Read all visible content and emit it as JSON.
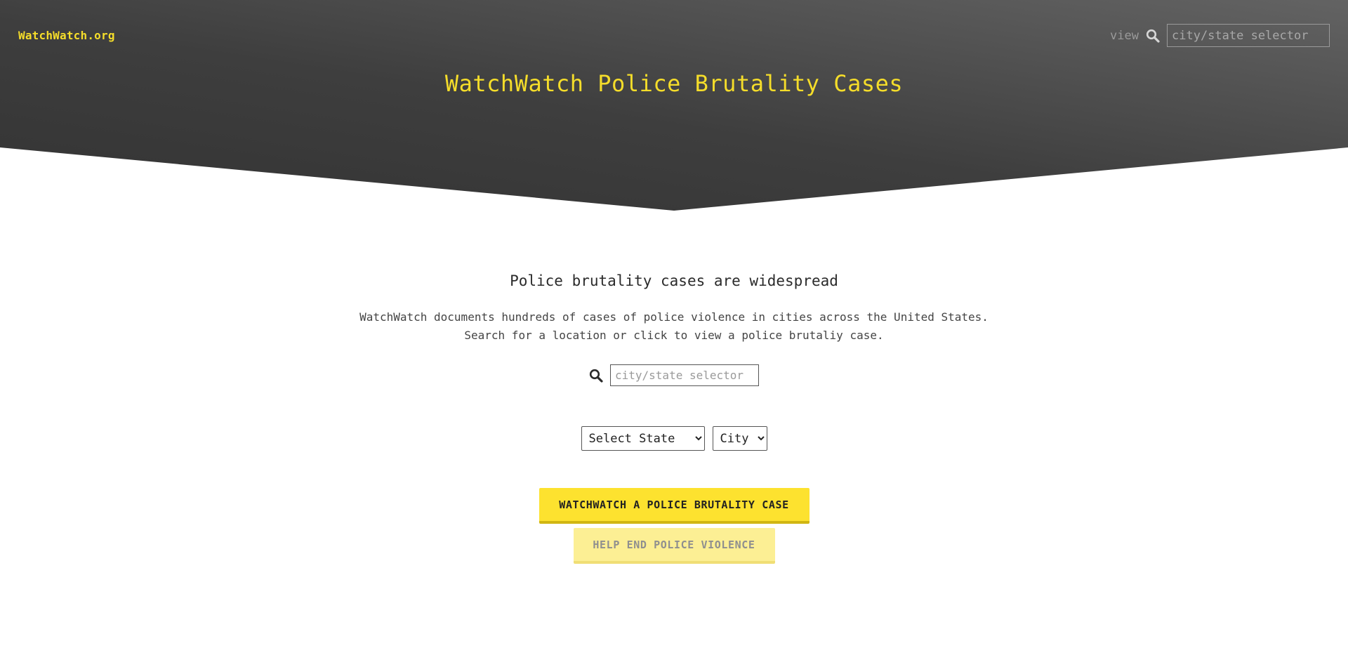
{
  "header": {
    "brand": "WatchWatch.org",
    "view_label": "view",
    "search_icon": "search-icon",
    "search_placeholder": "city/state selector",
    "title": "WatchWatch Police Brutality Cases"
  },
  "main": {
    "section_title": "Police brutality cases are widespread",
    "description_line1": "WatchWatch documents hundreds of cases of police violence in cities across the United States.",
    "description_line2": "Search for a location or click to view a police brutaliy case.",
    "search_icon": "search-icon",
    "search_placeholder": "city/state selector",
    "state_select": {
      "selected": "Select State"
    },
    "city_select": {
      "selected": "City"
    },
    "primary_button": "WATCHWATCH A POLICE BRUTALITY CASE",
    "secondary_button": "HELP END POLICE VIOLENCE"
  },
  "colors": {
    "accent_yellow": "#fde22f",
    "hero_dark": "#3a3a3a",
    "hero_light": "#606060"
  }
}
